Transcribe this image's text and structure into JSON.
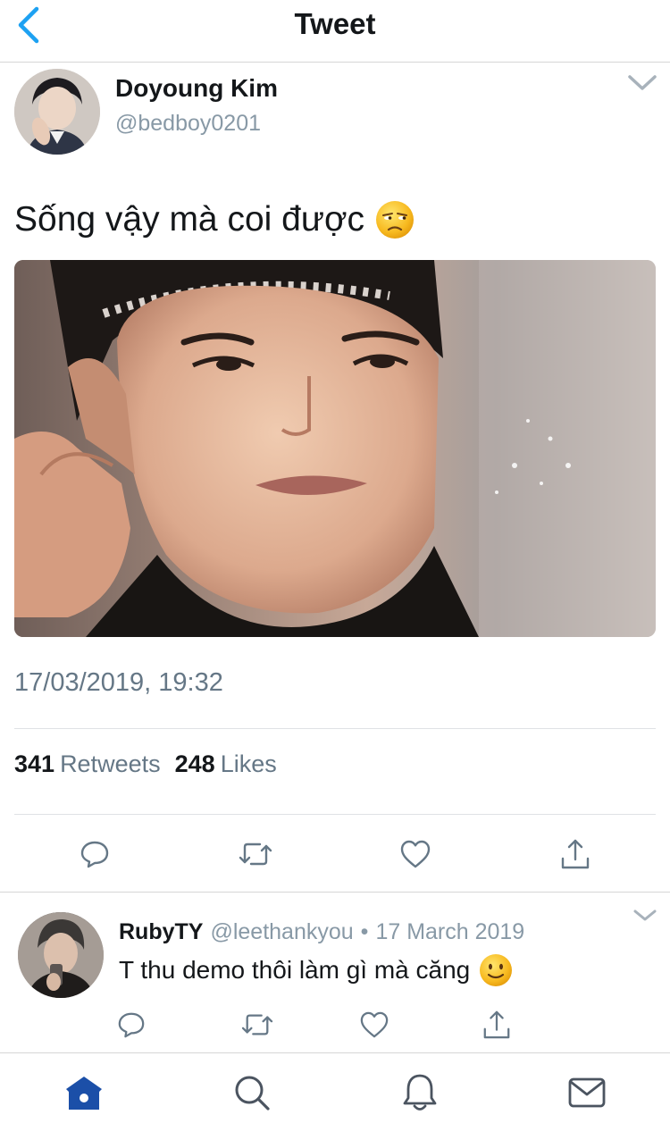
{
  "header": {
    "title": "Tweet",
    "back_icon": "chevron-left-icon"
  },
  "tweet": {
    "author_name": "Doyoung Kim",
    "author_handle": "@bedboy0201",
    "text": "Sống vậy mà coi được",
    "emoji": "unamused-face-emoji",
    "timestamp": "17/03/2019, 19:32",
    "retweets_count": "341",
    "retweets_label": "Retweets",
    "likes_count": "248",
    "likes_label": "Likes",
    "actions": [
      "reply-icon",
      "retweet-icon",
      "like-icon",
      "share-icon"
    ]
  },
  "reply": {
    "author_name": "RubyTY",
    "author_handle": "@leethankyou",
    "separator": "•",
    "date": "17 March 2019",
    "text": "T thu demo thôi làm gì mà căng",
    "emoji": "slightly-smiling-face-emoji"
  },
  "tabbar": {
    "items": [
      "home-icon",
      "search-icon",
      "notifications-icon",
      "messages-icon"
    ],
    "active": "home-icon"
  },
  "colors": {
    "accent": "#1da1f2",
    "home_active": "#1b4fa8",
    "text_primary": "#14171a",
    "text_secondary": "#657786",
    "handle_gray": "#8899a6",
    "divider": "#dfe2e5"
  }
}
